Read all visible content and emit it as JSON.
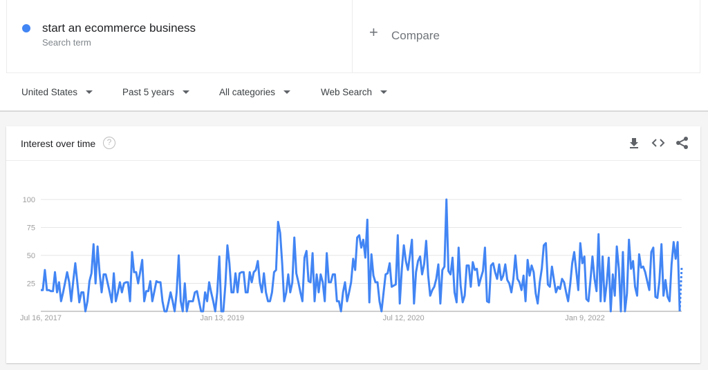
{
  "search_term": {
    "label": "start an ecommerce business",
    "sublabel": "Search term",
    "color": "#4285f4"
  },
  "compare": {
    "label": "Compare",
    "icon": "plus-icon"
  },
  "filters": [
    {
      "label": "United States"
    },
    {
      "label": "Past 5 years"
    },
    {
      "label": "All categories"
    },
    {
      "label": "Web Search"
    }
  ],
  "card": {
    "title": "Interest over time",
    "help_icon": "?",
    "actions": [
      "download-icon",
      "embed-code-icon",
      "share-icon"
    ]
  },
  "chart_data": {
    "type": "line",
    "title": "Interest over time",
    "xlabel": "",
    "ylabel": "",
    "ylim": [
      0,
      100
    ],
    "yticks": [
      25,
      50,
      75,
      100
    ],
    "xtick_labels": [
      "Jul 16, 2017",
      "Jan 13, 2019",
      "Jul 12, 2020",
      "Jan 9, 2022"
    ],
    "x_range": [
      "Jul 16, 2017",
      "Jul 2022"
    ],
    "grid": true,
    "legend": "none",
    "series": [
      {
        "name": "start an ecommerce business",
        "color": "#4285f4",
        "partial_last_point": true,
        "values": [
          19,
          19,
          37,
          19,
          19,
          18,
          18,
          35,
          17,
          26,
          9,
          17,
          26,
          35,
          26,
          9,
          27,
          43,
          26,
          8,
          17,
          17,
          0,
          9,
          27,
          34,
          60,
          25,
          58,
          34,
          17,
          33,
          33,
          25,
          17,
          8,
          34,
          9,
          17,
          26,
          17,
          25,
          26,
          26,
          9,
          53,
          35,
          35,
          25,
          35,
          46,
          9,
          18,
          18,
          27,
          9,
          18,
          27,
          26,
          26,
          9,
          0,
          0,
          8,
          17,
          9,
          0,
          17,
          50,
          9,
          0,
          25,
          0,
          9,
          9,
          9,
          17,
          18,
          9,
          0,
          0,
          17,
          9,
          26,
          17,
          9,
          0,
          17,
          49,
          0,
          0,
          24,
          59,
          43,
          17,
          17,
          34,
          17,
          34,
          35,
          35,
          17,
          17,
          35,
          26,
          35,
          37,
          45,
          26,
          17,
          34,
          17,
          9,
          9,
          17,
          35,
          37,
          80,
          70,
          43,
          9,
          17,
          33,
          17,
          26,
          66,
          34,
          26,
          17,
          9,
          48,
          54,
          27,
          26,
          52,
          9,
          33,
          17,
          33,
          26,
          9,
          52,
          26,
          26,
          33,
          33,
          9,
          9,
          0,
          17,
          26,
          9,
          17,
          26,
          47,
          37,
          66,
          68,
          57,
          64,
          48,
          82,
          8,
          51,
          32,
          26,
          26,
          9,
          0,
          17,
          33,
          34,
          43,
          22,
          23,
          24,
          68,
          7,
          38,
          59,
          45,
          37,
          50,
          64,
          7,
          35,
          45,
          49,
          33,
          42,
          63,
          32,
          14,
          19,
          22,
          29,
          42,
          7,
          37,
          40,
          100,
          36,
          33,
          48,
          17,
          8,
          57,
          23,
          8,
          14,
          41,
          41,
          22,
          44,
          37,
          38,
          23,
          30,
          36,
          57,
          9,
          8,
          41,
          43,
          35,
          29,
          42,
          28,
          32,
          42,
          28,
          25,
          17,
          29,
          50,
          29,
          26,
          19,
          32,
          9,
          46,
          32,
          41,
          35,
          16,
          7,
          26,
          38,
          59,
          61,
          24,
          22,
          40,
          28,
          17,
          22,
          20,
          29,
          26,
          17,
          9,
          24,
          43,
          53,
          36,
          19,
          61,
          43,
          49,
          11,
          9,
          28,
          49,
          29,
          18,
          69,
          9,
          49,
          9,
          25,
          48,
          0,
          33,
          14,
          58,
          38,
          0,
          53,
          0,
          16,
          64,
          38,
          45,
          22,
          14,
          51,
          39,
          40,
          35,
          27,
          19,
          53,
          57,
          13,
          12,
          27,
          60,
          14,
          28,
          13,
          9,
          42,
          62,
          47,
          62,
          0,
          40
        ]
      }
    ]
  }
}
